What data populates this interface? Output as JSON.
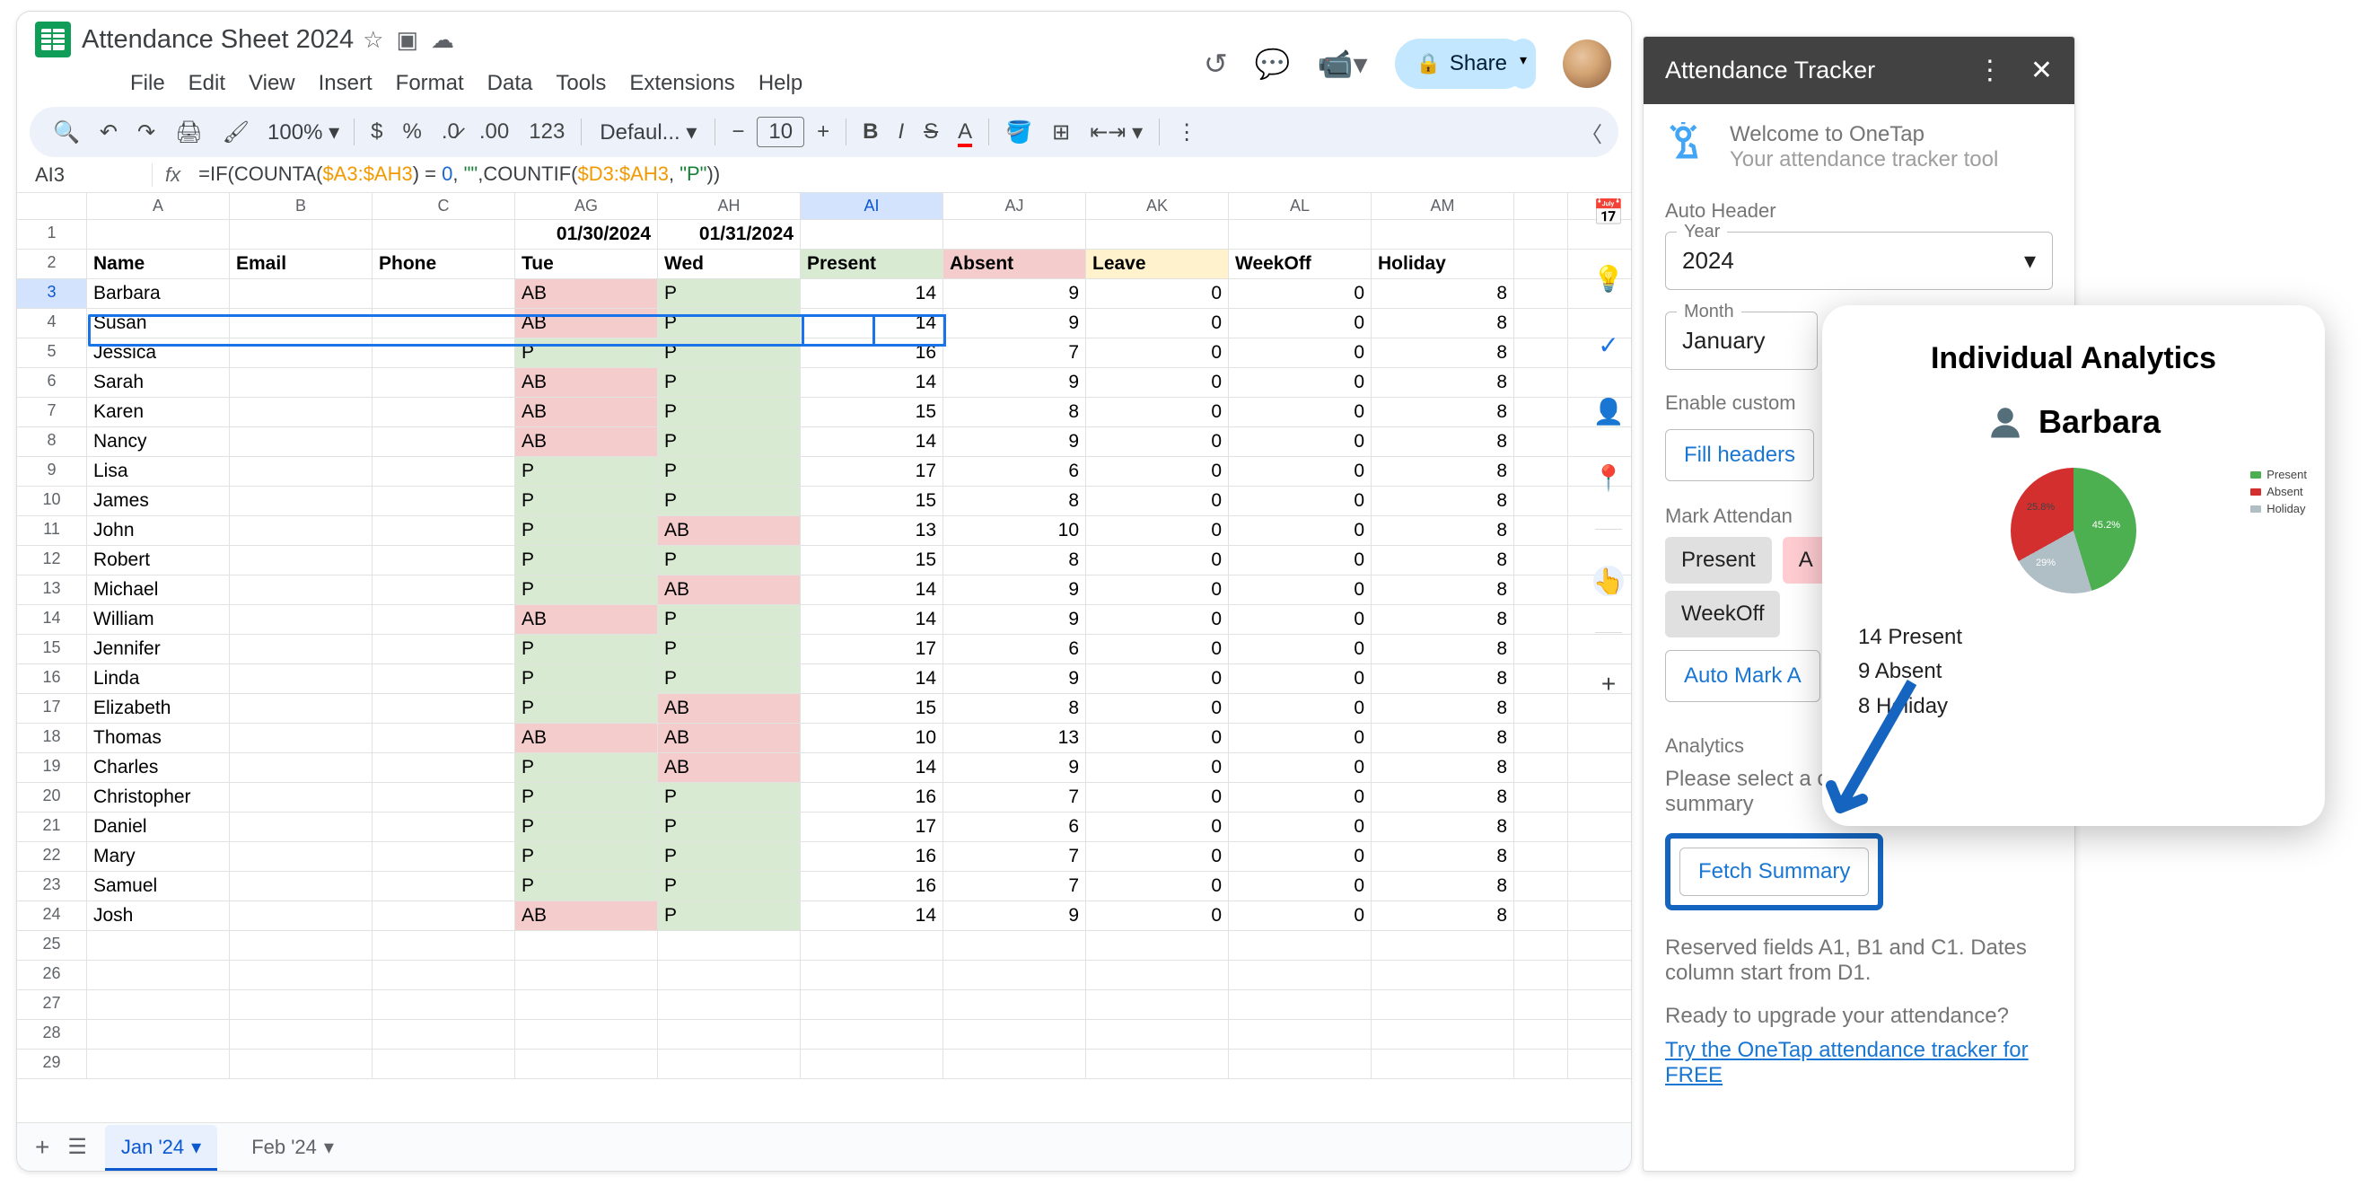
{
  "doc_title": "Attendance Sheet 2024",
  "menubar": [
    "File",
    "Edit",
    "View",
    "Insert",
    "Format",
    "Data",
    "Tools",
    "Extensions",
    "Help"
  ],
  "toolbar": {
    "zoom": "100%",
    "font": "Defaul...",
    "size": "10"
  },
  "share_label": "Share",
  "cell_ref": "AI3",
  "formula_prefix": "=IF(COUNTA(",
  "formula_range1": "$A3:$AH3",
  "formula_mid1": ") = ",
  "formula_num": "0",
  "formula_mid2": ", ",
  "formula_str1": "\"\"",
  "formula_mid3": ",COUNTIF(",
  "formula_range2": "$D3:$AH3",
  "formula_mid4": ", ",
  "formula_str2": "\"P\"",
  "formula_end": "))",
  "columns": [
    "A",
    "B",
    "C",
    "AG",
    "AH",
    "AI",
    "AJ",
    "AK",
    "AL",
    "AM"
  ],
  "date_row": {
    "AG": "01/30/2024",
    "AH": "01/31/2024"
  },
  "header_row": {
    "A": "Name",
    "B": "Email",
    "C": "Phone",
    "AG": "Tue",
    "AH": "Wed",
    "AI": "Present",
    "AJ": "Absent",
    "AK": "Leave",
    "AL": "WeekOff",
    "AM": "Holiday"
  },
  "rows": [
    {
      "n": 3,
      "A": "Barbara",
      "AG": "AB",
      "AH": "P",
      "AI": 14,
      "AJ": 9,
      "AK": 0,
      "AL": 0,
      "AM": 8
    },
    {
      "n": 4,
      "A": "Susan",
      "AG": "AB",
      "AH": "P",
      "AI": 14,
      "AJ": 9,
      "AK": 0,
      "AL": 0,
      "AM": 8
    },
    {
      "n": 5,
      "A": "Jessica",
      "AG": "P",
      "AH": "P",
      "AI": 16,
      "AJ": 7,
      "AK": 0,
      "AL": 0,
      "AM": 8
    },
    {
      "n": 6,
      "A": "Sarah",
      "AG": "AB",
      "AH": "P",
      "AI": 14,
      "AJ": 9,
      "AK": 0,
      "AL": 0,
      "AM": 8
    },
    {
      "n": 7,
      "A": "Karen",
      "AG": "AB",
      "AH": "P",
      "AI": 15,
      "AJ": 8,
      "AK": 0,
      "AL": 0,
      "AM": 8
    },
    {
      "n": 8,
      "A": "Nancy",
      "AG": "AB",
      "AH": "P",
      "AI": 14,
      "AJ": 9,
      "AK": 0,
      "AL": 0,
      "AM": 8
    },
    {
      "n": 9,
      "A": "Lisa",
      "AG": "P",
      "AH": "P",
      "AI": 17,
      "AJ": 6,
      "AK": 0,
      "AL": 0,
      "AM": 8
    },
    {
      "n": 10,
      "A": "James",
      "AG": "P",
      "AH": "P",
      "AI": 15,
      "AJ": 8,
      "AK": 0,
      "AL": 0,
      "AM": 8
    },
    {
      "n": 11,
      "A": "John",
      "AG": "P",
      "AH": "AB",
      "AI": 13,
      "AJ": 10,
      "AK": 0,
      "AL": 0,
      "AM": 8
    },
    {
      "n": 12,
      "A": "Robert",
      "AG": "P",
      "AH": "P",
      "AI": 15,
      "AJ": 8,
      "AK": 0,
      "AL": 0,
      "AM": 8
    },
    {
      "n": 13,
      "A": "Michael",
      "AG": "P",
      "AH": "AB",
      "AI": 14,
      "AJ": 9,
      "AK": 0,
      "AL": 0,
      "AM": 8
    },
    {
      "n": 14,
      "A": "William",
      "AG": "AB",
      "AH": "P",
      "AI": 14,
      "AJ": 9,
      "AK": 0,
      "AL": 0,
      "AM": 8
    },
    {
      "n": 15,
      "A": "Jennifer",
      "AG": "P",
      "AH": "P",
      "AI": 17,
      "AJ": 6,
      "AK": 0,
      "AL": 0,
      "AM": 8
    },
    {
      "n": 16,
      "A": "Linda",
      "AG": "P",
      "AH": "P",
      "AI": 14,
      "AJ": 9,
      "AK": 0,
      "AL": 0,
      "AM": 8
    },
    {
      "n": 17,
      "A": "Elizabeth",
      "AG": "P",
      "AH": "AB",
      "AI": 15,
      "AJ": 8,
      "AK": 0,
      "AL": 0,
      "AM": 8
    },
    {
      "n": 18,
      "A": "Thomas",
      "AG": "AB",
      "AH": "AB",
      "AI": 10,
      "AJ": 13,
      "AK": 0,
      "AL": 0,
      "AM": 8
    },
    {
      "n": 19,
      "A": "Charles",
      "AG": "P",
      "AH": "AB",
      "AI": 14,
      "AJ": 9,
      "AK": 0,
      "AL": 0,
      "AM": 8
    },
    {
      "n": 20,
      "A": "Christopher",
      "AG": "P",
      "AH": "P",
      "AI": 16,
      "AJ": 7,
      "AK": 0,
      "AL": 0,
      "AM": 8
    },
    {
      "n": 21,
      "A": "Daniel",
      "AG": "P",
      "AH": "P",
      "AI": 17,
      "AJ": 6,
      "AK": 0,
      "AL": 0,
      "AM": 8
    },
    {
      "n": 22,
      "A": "Mary",
      "AG": "P",
      "AH": "P",
      "AI": 16,
      "AJ": 7,
      "AK": 0,
      "AL": 0,
      "AM": 8
    },
    {
      "n": 23,
      "A": "Samuel",
      "AG": "P",
      "AH": "P",
      "AI": 16,
      "AJ": 7,
      "AK": 0,
      "AL": 0,
      "AM": 8
    },
    {
      "n": 24,
      "A": "Josh",
      "AG": "AB",
      "AH": "P",
      "AI": 14,
      "AJ": 9,
      "AK": 0,
      "AL": 0,
      "AM": 8
    }
  ],
  "empty_rows": [
    25,
    26,
    27,
    28,
    29
  ],
  "sheet_tabs": {
    "active": "Jan '24",
    "other": "Feb '24"
  },
  "sidebar": {
    "title": "Attendance Tracker",
    "welcome_title": "Welcome to OneTap",
    "welcome_sub": "Your attendance tracker tool",
    "auto_header": "Auto Header",
    "year_label": "Year",
    "year": "2024",
    "month_label": "Month",
    "month": "January",
    "enable_custom": "Enable custom",
    "fill_headers": "Fill headers",
    "mark_attendance": "Mark Attendan",
    "present": "Present",
    "a_label": "A",
    "weekoff": "WeekOff",
    "auto_mark": "Auto Mark A",
    "analytics": "Analytics",
    "select_text": "Please select a cell to see the student's summary",
    "fetch": "Fetch Summary",
    "reserved": "Reserved fields A1, B1 and C1. Dates column start from D1.",
    "upgrade": "Ready to upgrade your attendance?",
    "upgrade_link": "Try the OneTap attendance tracker for FREE"
  },
  "analytics_popup": {
    "title": "Individual Analytics",
    "name": "Barbara",
    "stat1": "14 Present",
    "stat2": "9 Absent",
    "stat3": "8 Holiday",
    "legend": [
      "Present",
      "Absent",
      "Holiday"
    ],
    "pie_labels": {
      "present": "45.2%",
      "holiday": "25.8%",
      "absent": "29%"
    }
  },
  "chart_data": {
    "type": "pie",
    "title": "Individual Analytics",
    "categories": [
      "Present",
      "Absent",
      "Holiday"
    ],
    "values": [
      14,
      9,
      8
    ],
    "percentages": [
      45.2,
      29.0,
      25.8
    ],
    "colors": [
      "#4caf50",
      "#d32f2f",
      "#b0bec5"
    ]
  }
}
